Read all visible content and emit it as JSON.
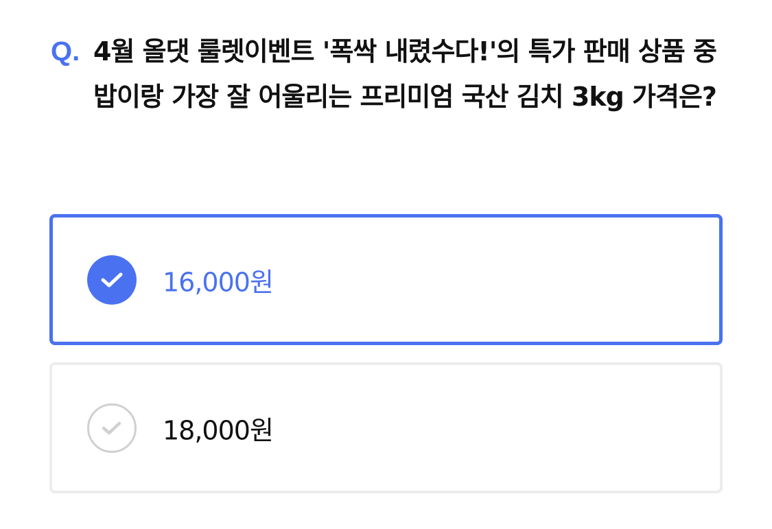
{
  "question": {
    "prefix": "Q.",
    "text": "4월 올댓 룰렛이벤트 '폭싹 내렸수다!'의 특가 판매 상품 중 밥이랑 가장 잘 어울리는 프리미엄 국산 김치 3kg 가격은?"
  },
  "options": [
    {
      "label": "16,000원",
      "selected": true,
      "icon": "check-circle-filled-icon"
    },
    {
      "label": "18,000원",
      "selected": false,
      "icon": "check-circle-outline-icon"
    }
  ],
  "colors": {
    "accent": "#4a72f0",
    "text": "#111111",
    "unselected_border": "#ececec",
    "unselected_check": "#d0d0d0"
  }
}
